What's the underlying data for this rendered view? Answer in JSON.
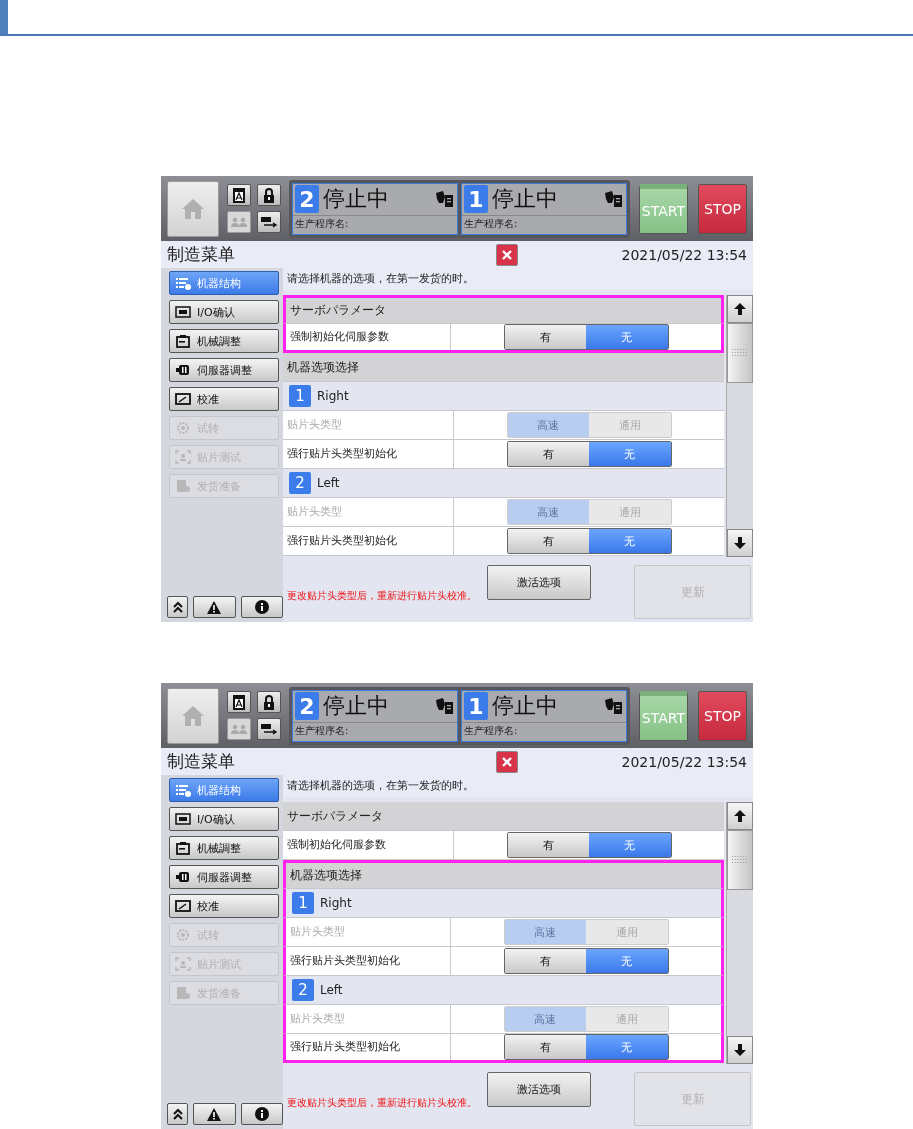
{
  "screenshots": [
    {
      "units": [
        {
          "number": "2",
          "status": "停止中",
          "label": "生产程序名:"
        },
        {
          "number": "1",
          "status": "停止中",
          "label": "生产程序名:"
        }
      ],
      "start": "START",
      "stop": "STOP",
      "title": "制造菜单",
      "datetime": "2021/05/22 13:54",
      "sidebar": [
        {
          "label": "机器结构",
          "selected": true,
          "disabled": false
        },
        {
          "label": "I/O确认",
          "selected": false,
          "disabled": false
        },
        {
          "label": "机械調整",
          "selected": false,
          "disabled": false
        },
        {
          "label": "伺服器调整",
          "selected": false,
          "disabled": false
        },
        {
          "label": "校准",
          "selected": false,
          "disabled": false
        },
        {
          "label": "试转",
          "selected": false,
          "disabled": true
        },
        {
          "label": "贴片测试",
          "selected": false,
          "disabled": true
        },
        {
          "label": "发货准备",
          "selected": false,
          "disabled": true
        }
      ],
      "message": "请选择机器的选项，在第一发货的时。",
      "rows": [
        {
          "kind": "section",
          "label": "サーボパラメータ",
          "highlighted": true
        },
        {
          "kind": "option",
          "label": "强制初始化伺服参数",
          "disabled": false,
          "highlighted": true,
          "options": [
            {
              "label": "有",
              "selected": false
            },
            {
              "label": "无",
              "selected": true
            }
          ]
        },
        {
          "kind": "section",
          "label": "机器选项选择",
          "highlighted": false
        },
        {
          "kind": "unit",
          "number": "1",
          "label": "Right",
          "highlighted": false
        },
        {
          "kind": "option",
          "label": "贴片头类型",
          "disabled": true,
          "highlighted": false,
          "options": [
            {
              "label": "高速",
              "selected": true
            },
            {
              "label": "通用",
              "selected": false
            }
          ]
        },
        {
          "kind": "option",
          "label": "强行贴片头类型初始化",
          "disabled": false,
          "highlighted": false,
          "options": [
            {
              "label": "有",
              "selected": false
            },
            {
              "label": "无",
              "selected": true
            }
          ]
        },
        {
          "kind": "unit",
          "number": "2",
          "label": "Left",
          "highlighted": false
        },
        {
          "kind": "option",
          "label": "贴片头类型",
          "disabled": true,
          "highlighted": false,
          "options": [
            {
              "label": "高速",
              "selected": true
            },
            {
              "label": "通用",
              "selected": false
            }
          ]
        },
        {
          "kind": "option",
          "label": "强行贴片头类型初始化",
          "disabled": false,
          "highlighted": false,
          "options": [
            {
              "label": "有",
              "selected": false
            },
            {
              "label": "无",
              "selected": true
            }
          ]
        }
      ],
      "warning": "更改贴片头类型后，重新进行贴片头校准。",
      "activate": "激活选项",
      "update": "更新"
    },
    {
      "units": [
        {
          "number": "2",
          "status": "停止中",
          "label": "生产程序名:"
        },
        {
          "number": "1",
          "status": "停止中",
          "label": "生产程序名:"
        }
      ],
      "start": "START",
      "stop": "STOP",
      "title": "制造菜单",
      "datetime": "2021/05/22 13:54",
      "sidebar": [
        {
          "label": "机器结构",
          "selected": true,
          "disabled": false
        },
        {
          "label": "I/O确认",
          "selected": false,
          "disabled": false
        },
        {
          "label": "机械調整",
          "selected": false,
          "disabled": false
        },
        {
          "label": "伺服器调整",
          "selected": false,
          "disabled": false
        },
        {
          "label": "校准",
          "selected": false,
          "disabled": false
        },
        {
          "label": "试转",
          "selected": false,
          "disabled": true
        },
        {
          "label": "贴片测试",
          "selected": false,
          "disabled": true
        },
        {
          "label": "发货准备",
          "selected": false,
          "disabled": true
        }
      ],
      "message": "请选择机器的选项，在第一发货的时。",
      "rows": [
        {
          "kind": "section",
          "label": "サーボパラメータ",
          "highlighted": false
        },
        {
          "kind": "option",
          "label": "强制初始化伺服参数",
          "disabled": false,
          "highlighted": false,
          "options": [
            {
              "label": "有",
              "selected": false
            },
            {
              "label": "无",
              "selected": true
            }
          ]
        },
        {
          "kind": "section",
          "label": "机器选项选择",
          "highlighted": true
        },
        {
          "kind": "unit",
          "number": "1",
          "label": "Right",
          "highlighted": true
        },
        {
          "kind": "option",
          "label": "贴片头类型",
          "disabled": true,
          "highlighted": true,
          "options": [
            {
              "label": "高速",
              "selected": true
            },
            {
              "label": "通用",
              "selected": false
            }
          ]
        },
        {
          "kind": "option",
          "label": "强行贴片头类型初始化",
          "disabled": false,
          "highlighted": true,
          "options": [
            {
              "label": "有",
              "selected": false
            },
            {
              "label": "无",
              "selected": true
            }
          ]
        },
        {
          "kind": "unit",
          "number": "2",
          "label": "Left",
          "highlighted": true
        },
        {
          "kind": "option",
          "label": "贴片头类型",
          "disabled": true,
          "highlighted": true,
          "options": [
            {
              "label": "高速",
              "selected": true
            },
            {
              "label": "通用",
              "selected": false
            }
          ]
        },
        {
          "kind": "option",
          "label": "强行贴片头类型初始化",
          "disabled": false,
          "highlighted": true,
          "options": [
            {
              "label": "有",
              "selected": false
            },
            {
              "label": "无",
              "selected": true
            }
          ]
        }
      ],
      "warning": "更改贴片头类型后，重新进行贴片头校准。",
      "activate": "激活选项",
      "update": "更新"
    }
  ]
}
